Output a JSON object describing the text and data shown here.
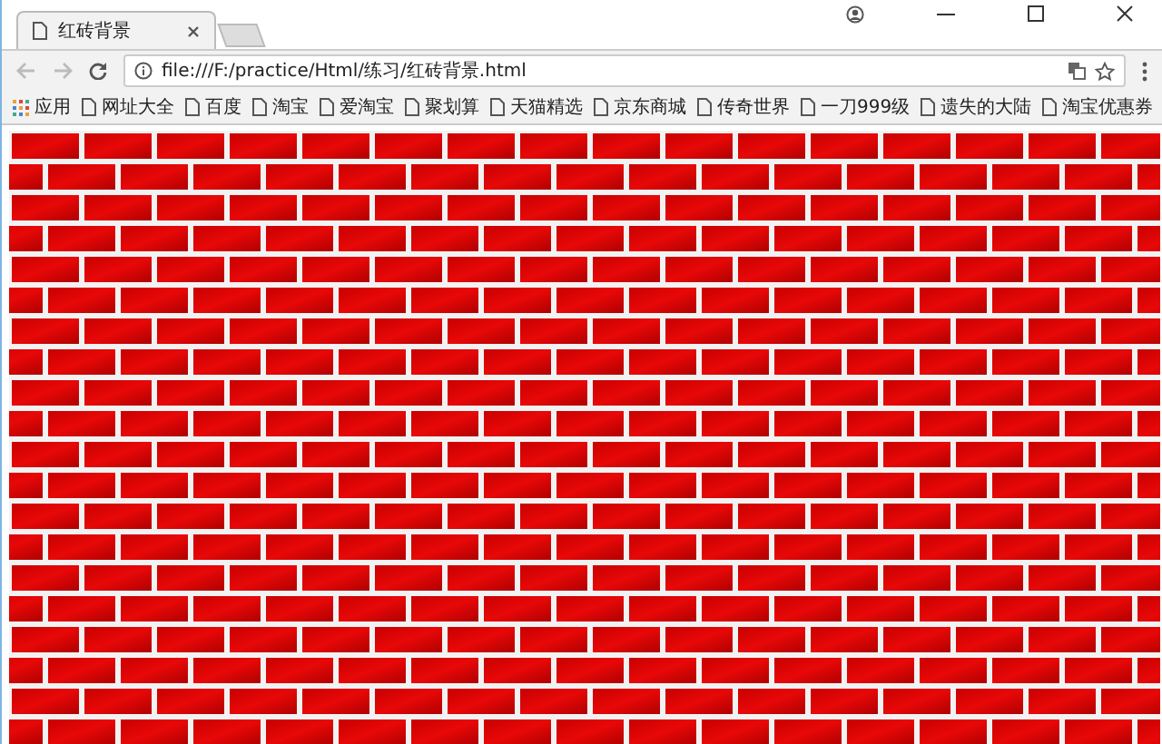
{
  "tabs": [
    {
      "title": "红砖背景",
      "selected": true
    }
  ],
  "address_bar": {
    "url": "file:///F:/practice/Html/练习/红砖背景.html"
  },
  "bookmarks": [
    {
      "label": "应用",
      "kind": "apps"
    },
    {
      "label": "网址大全",
      "kind": "page"
    },
    {
      "label": "百度",
      "kind": "page"
    },
    {
      "label": "淘宝",
      "kind": "page"
    },
    {
      "label": "爱淘宝",
      "kind": "page"
    },
    {
      "label": "聚划算",
      "kind": "page"
    },
    {
      "label": "天猫精选",
      "kind": "page"
    },
    {
      "label": "京东商城",
      "kind": "page"
    },
    {
      "label": "传奇世界",
      "kind": "page"
    },
    {
      "label": "一刀999级",
      "kind": "page"
    },
    {
      "label": "遗失的大陆",
      "kind": "page"
    },
    {
      "label": "淘宝优惠券",
      "kind": "page"
    }
  ]
}
